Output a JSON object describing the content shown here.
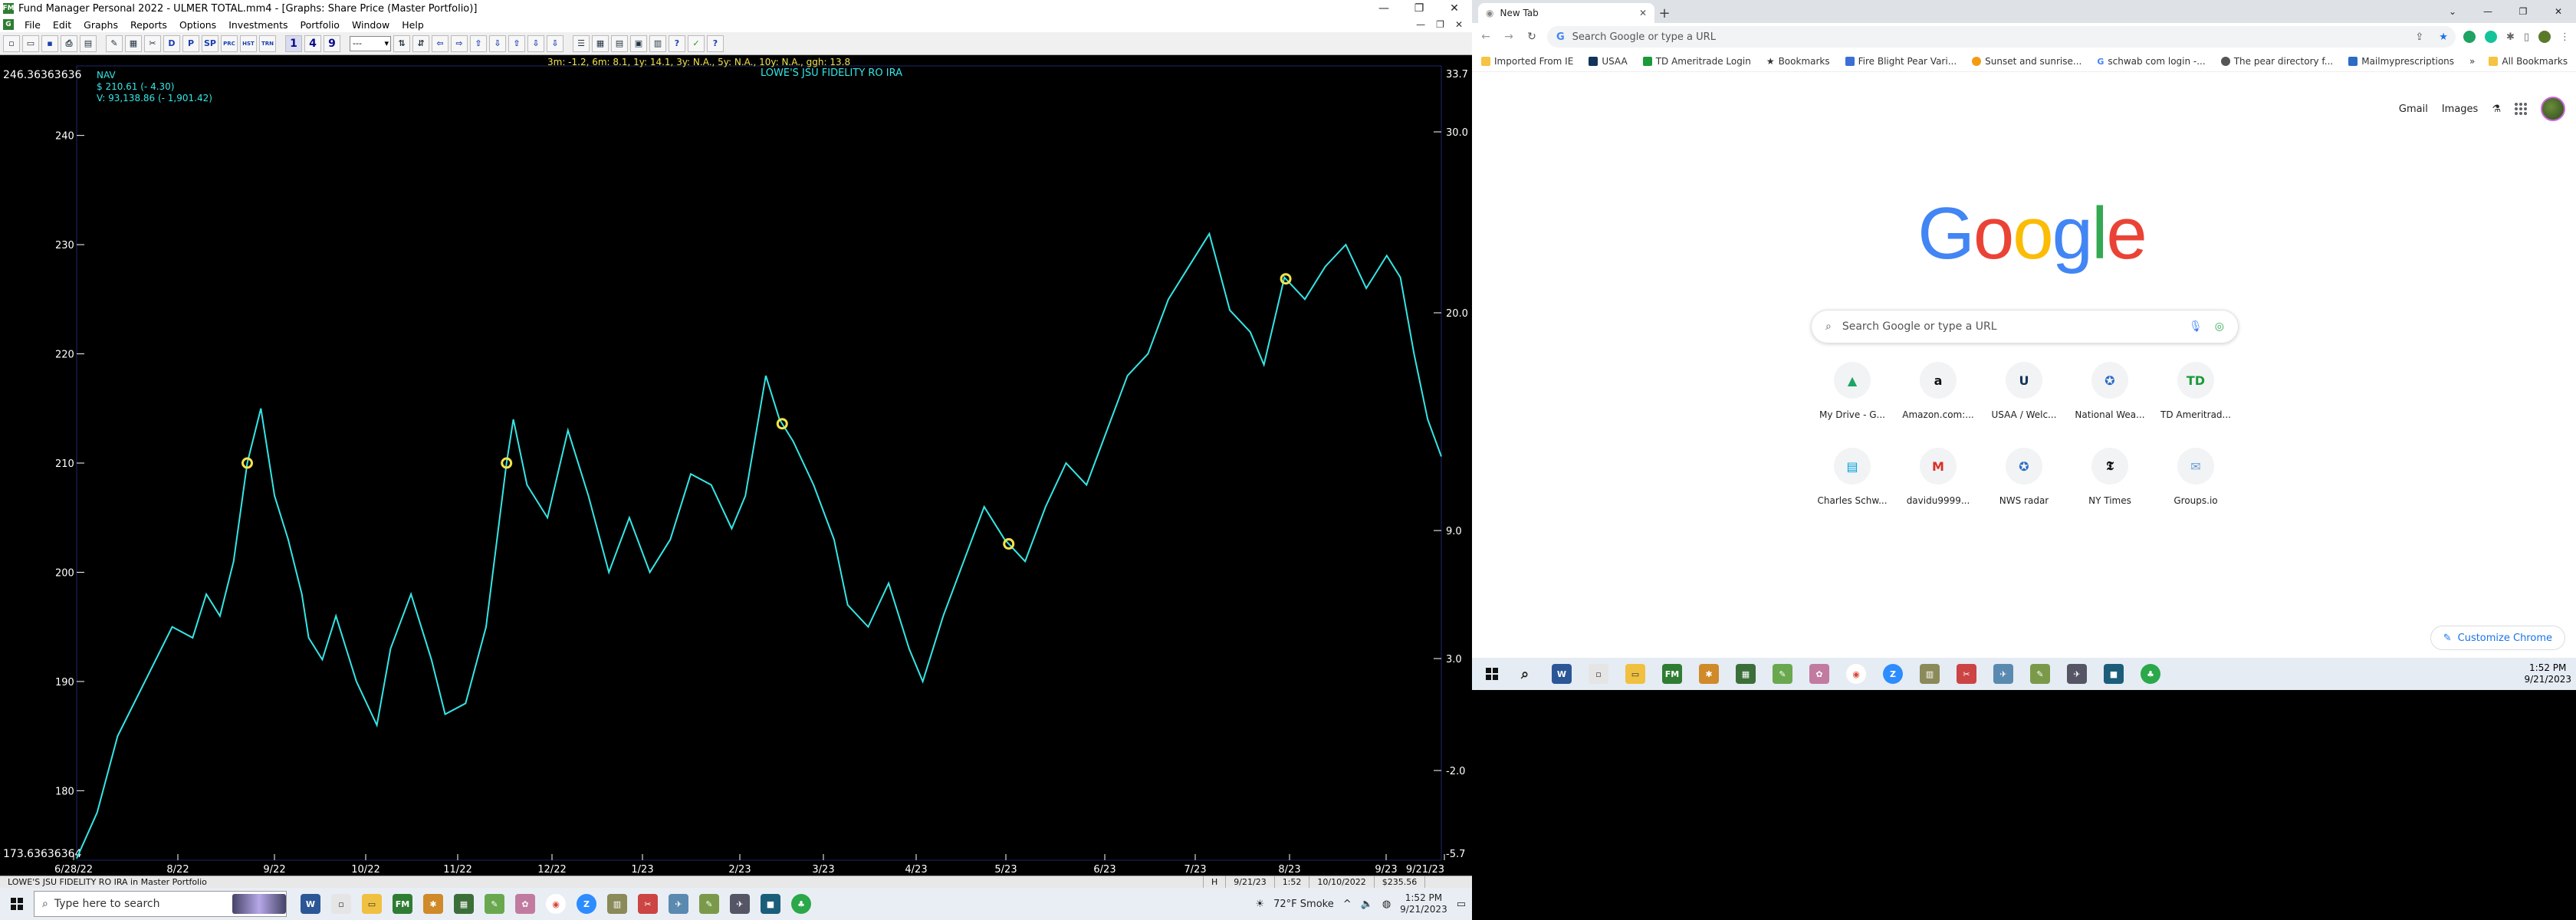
{
  "fm": {
    "title": "Fund Manager Personal 2022 - ULMER TOTAL.mm4 - [Graphs: Share Price (Master Portfolio)]",
    "menus": [
      "File",
      "Edit",
      "Graphs",
      "Reports",
      "Options",
      "Investments",
      "Portfolio",
      "Window",
      "Help"
    ],
    "window_controls": {
      "minimize": "—",
      "restore": "❐",
      "close": "✕"
    },
    "toolbar": {
      "num_buttons": [
        "1",
        "4",
        "9"
      ],
      "text_buttons": [
        "D",
        "P",
        "SP",
        "PRC",
        "HST",
        "TRN"
      ],
      "combo": "---"
    },
    "chart": {
      "top_left_value": "246.36363636",
      "bottom_left_value": "173.63636364",
      "legend_title": "NAV",
      "legend_price": "$ 210.61 (- 4.30)",
      "legend_value": "V: 93,138.86 (- 1,901.42)",
      "returns": "3m: -1.2,    6m: 8.1,    1y: 14.1,    3y: N.A.,    5y: N.A.,    10y: N.A.,    ggh: 13.8",
      "fund_name": "LOWE'S JSU FIDELITY RO IRA",
      "right_top": "33.7",
      "right_bottom": "-5.7"
    },
    "status": {
      "left": "LOWE'S JSU FIDELITY RO IRA in Master Portfolio",
      "h": "H",
      "date": "9/21/23",
      "time": "1:52",
      "range": "10/10/2022",
      "value": "$235.56"
    }
  },
  "chart_data": {
    "type": "line",
    "title": "",
    "xlabel": "",
    "ylabel": "",
    "ylim": [
      173.63636364,
      246.36363636
    ],
    "y_ticks": [
      180,
      190,
      200,
      210,
      220,
      230,
      240
    ],
    "y_right_ticks": [
      "30.0",
      "20.0",
      "9.0",
      "3.0",
      "-2.0"
    ],
    "x_tick_labels": [
      "6/28/22",
      "8/22",
      "9/22",
      "10/22",
      "11/22",
      "12/22",
      "1/23",
      "2/23",
      "3/23",
      "4/23",
      "5/23",
      "6/23",
      "7/23",
      "8/23",
      "9/23",
      "9/21/23"
    ],
    "series": [
      {
        "name": "NAV",
        "x": [
          0,
          0.015,
          0.03,
          0.05,
          0.07,
          0.085,
          0.095,
          0.105,
          0.115,
          0.125,
          0.135,
          0.145,
          0.155,
          0.165,
          0.17,
          0.18,
          0.19,
          0.205,
          0.22,
          0.23,
          0.245,
          0.26,
          0.27,
          0.285,
          0.3,
          0.315,
          0.32,
          0.33,
          0.345,
          0.36,
          0.375,
          0.39,
          0.405,
          0.42,
          0.435,
          0.45,
          0.465,
          0.48,
          0.49,
          0.505,
          0.515,
          0.525,
          0.54,
          0.555,
          0.565,
          0.58,
          0.595,
          0.61,
          0.62,
          0.635,
          0.65,
          0.665,
          0.68,
          0.695,
          0.71,
          0.725,
          0.74,
          0.755,
          0.77,
          0.785,
          0.8,
          0.815,
          0.83,
          0.845,
          0.86,
          0.87,
          0.885,
          0.9,
          0.915,
          0.93,
          0.945,
          0.96,
          0.97,
          0.98,
          0.99,
          1.0
        ],
        "values": [
          173.8,
          178,
          185,
          190,
          195,
          194,
          198,
          196,
          201,
          210,
          215,
          207,
          203,
          198,
          194,
          192,
          196,
          190,
          186,
          193,
          198,
          192,
          187,
          188,
          195,
          210,
          214,
          208,
          205,
          213,
          207,
          200,
          205,
          200,
          203,
          209,
          208,
          204,
          207,
          218,
          214,
          212,
          208,
          203,
          197,
          195,
          199,
          193,
          190,
          196,
          201,
          206,
          203,
          201,
          206,
          210,
          208,
          213,
          218,
          220,
          225,
          228,
          231,
          224,
          222,
          219,
          227,
          225,
          228,
          230,
          226,
          229,
          227,
          220,
          214,
          210.6
        ]
      }
    ],
    "markers_x": [
      0.125,
      0.315,
      0.517,
      0.683,
      0.886
    ],
    "grid": false,
    "colors": {
      "line": "#35e6e6",
      "markers": "#f2e34b",
      "background": "#000000"
    }
  },
  "taskbar_left": {
    "search_placeholder": "Type here to search",
    "weather": "72°F  Smoke",
    "time": "1:52 PM",
    "date": "9/21/2023"
  },
  "chrome": {
    "tab_title": "New Tab",
    "omnibox_placeholder": "Search Google or type a URL",
    "bookmarks": [
      "Imported From IE",
      "USAA",
      "TD Ameritrade Login",
      "Bookmarks",
      "Fire Blight Pear Vari...",
      "Sunset and sunrise...",
      "schwab com login -...",
      "The pear directory f...",
      "Mailmyprescriptions"
    ],
    "bookmarks_more": "»",
    "all_bookmarks": "All Bookmarks",
    "top_links": [
      "Gmail",
      "Images"
    ],
    "logo_letters": [
      "G",
      "o",
      "o",
      "g",
      "l",
      "e"
    ],
    "logo_colors": [
      "#4285F4",
      "#EA4335",
      "#FBBC05",
      "#4285F4",
      "#34A853",
      "#EA4335"
    ],
    "search_placeholder": "Search Google or type a URL",
    "shortcuts": [
      {
        "label": "My Drive - G...",
        "icon": "drive-icon",
        "glyph": "▲",
        "color": "#1fa463"
      },
      {
        "label": "Amazon.com:...",
        "icon": "amazon-icon",
        "glyph": "a",
        "color": "#111111"
      },
      {
        "label": "USAA / Welc...",
        "icon": "usaa-icon",
        "glyph": "U",
        "color": "#12345b"
      },
      {
        "label": "National Wea...",
        "icon": "nws-icon",
        "glyph": "✪",
        "color": "#2b6cc4"
      },
      {
        "label": "TD Ameritrad...",
        "icon": "td-icon",
        "glyph": "TD",
        "color": "#1b9a3a"
      },
      {
        "label": "Charles Schw...",
        "icon": "schwab-icon",
        "glyph": "▤",
        "color": "#00a0df"
      },
      {
        "label": "davidu9999...",
        "icon": "gmail-icon",
        "glyph": "M",
        "color": "#d93025"
      },
      {
        "label": "NWS radar",
        "icon": "nws-radar-icon",
        "glyph": "✪",
        "color": "#2b6cc4"
      },
      {
        "label": "NY Times",
        "icon": "nytimes-icon",
        "glyph": "𝕿",
        "color": "#111111"
      },
      {
        "label": "Groups.io",
        "icon": "groups-icon",
        "glyph": "✉",
        "color": "#6a9fd8"
      }
    ],
    "customize_label": "Customize Chrome"
  },
  "taskbar_right": {
    "time": "1:52 PM",
    "date": "9/21/2023"
  }
}
